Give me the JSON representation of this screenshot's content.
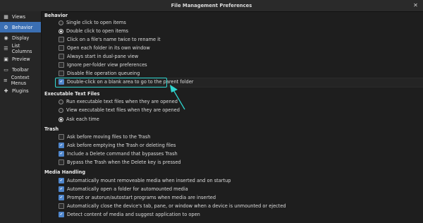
{
  "window": {
    "title": "File Management Preferences"
  },
  "sidebar": {
    "items": [
      {
        "label": "Views",
        "icon": "views-icon"
      },
      {
        "label": "Behavior",
        "icon": "gear-icon",
        "active": true
      },
      {
        "label": "Display",
        "icon": "eye-icon"
      },
      {
        "label": "List Columns",
        "icon": "list-icon"
      },
      {
        "label": "Preview",
        "icon": "image-icon"
      },
      {
        "label": "Toolbar",
        "icon": "toolbar-icon"
      },
      {
        "label": "Context Menus",
        "icon": "menu-icon"
      },
      {
        "label": "Plugins",
        "icon": "puzzle-icon"
      }
    ]
  },
  "behavior": {
    "heading": "Behavior",
    "options": [
      {
        "label": "Single click to open items",
        "type": "radio",
        "checked": false
      },
      {
        "label": "Double click to open items",
        "type": "radio",
        "checked": true
      },
      {
        "label": "Click on a file's name twice to rename it",
        "type": "checkbox",
        "checked": false
      },
      {
        "label": "Open each folder in its own window",
        "type": "checkbox",
        "checked": false
      },
      {
        "label": "Always start in dual-pane view",
        "type": "checkbox",
        "checked": false
      },
      {
        "label": "Ignore per-folder view preferences",
        "type": "checkbox",
        "checked": false
      },
      {
        "label": "Disable file operation queueing",
        "type": "checkbox",
        "checked": false
      },
      {
        "label": "Double-click on a blank area to go to the parent folder",
        "type": "checkbox",
        "checked": true
      }
    ]
  },
  "exec": {
    "heading": "Executable Text Files",
    "options": [
      {
        "label": "Run executable text files when they are opened",
        "type": "radio",
        "checked": false
      },
      {
        "label": "View executable text files when they are opened",
        "type": "radio",
        "checked": false
      },
      {
        "label": "Ask each time",
        "type": "radio",
        "checked": true
      }
    ]
  },
  "trash": {
    "heading": "Trash",
    "options": [
      {
        "label": "Ask before moving files to the Trash",
        "type": "checkbox",
        "checked": false
      },
      {
        "label": "Ask before emptying the Trash or deleting files",
        "type": "checkbox",
        "checked": true
      },
      {
        "label": "Include a Delete command that bypasses Trash",
        "type": "checkbox",
        "checked": true
      },
      {
        "label": "Bypass the Trash when the Delete key is pressed",
        "type": "checkbox",
        "checked": false
      }
    ]
  },
  "media": {
    "heading": "Media Handling",
    "options": [
      {
        "label": "Automatically mount removeable media when inserted and on startup",
        "type": "checkbox",
        "checked": true
      },
      {
        "label": "Automatically open a folder for automounted media",
        "type": "checkbox",
        "checked": true
      },
      {
        "label": "Prompt or autorun/autostart programs when media are inserted",
        "type": "checkbox",
        "checked": true
      },
      {
        "label": "Automatically close the device's tab, pane, or window when a device is unmounted or ejected",
        "type": "checkbox",
        "checked": false
      },
      {
        "label": "Detect content of media and suggest application to open",
        "type": "checkbox",
        "checked": true
      }
    ]
  },
  "colors": {
    "accent": "#3b6fb3",
    "callout": "#2fd6d0"
  }
}
